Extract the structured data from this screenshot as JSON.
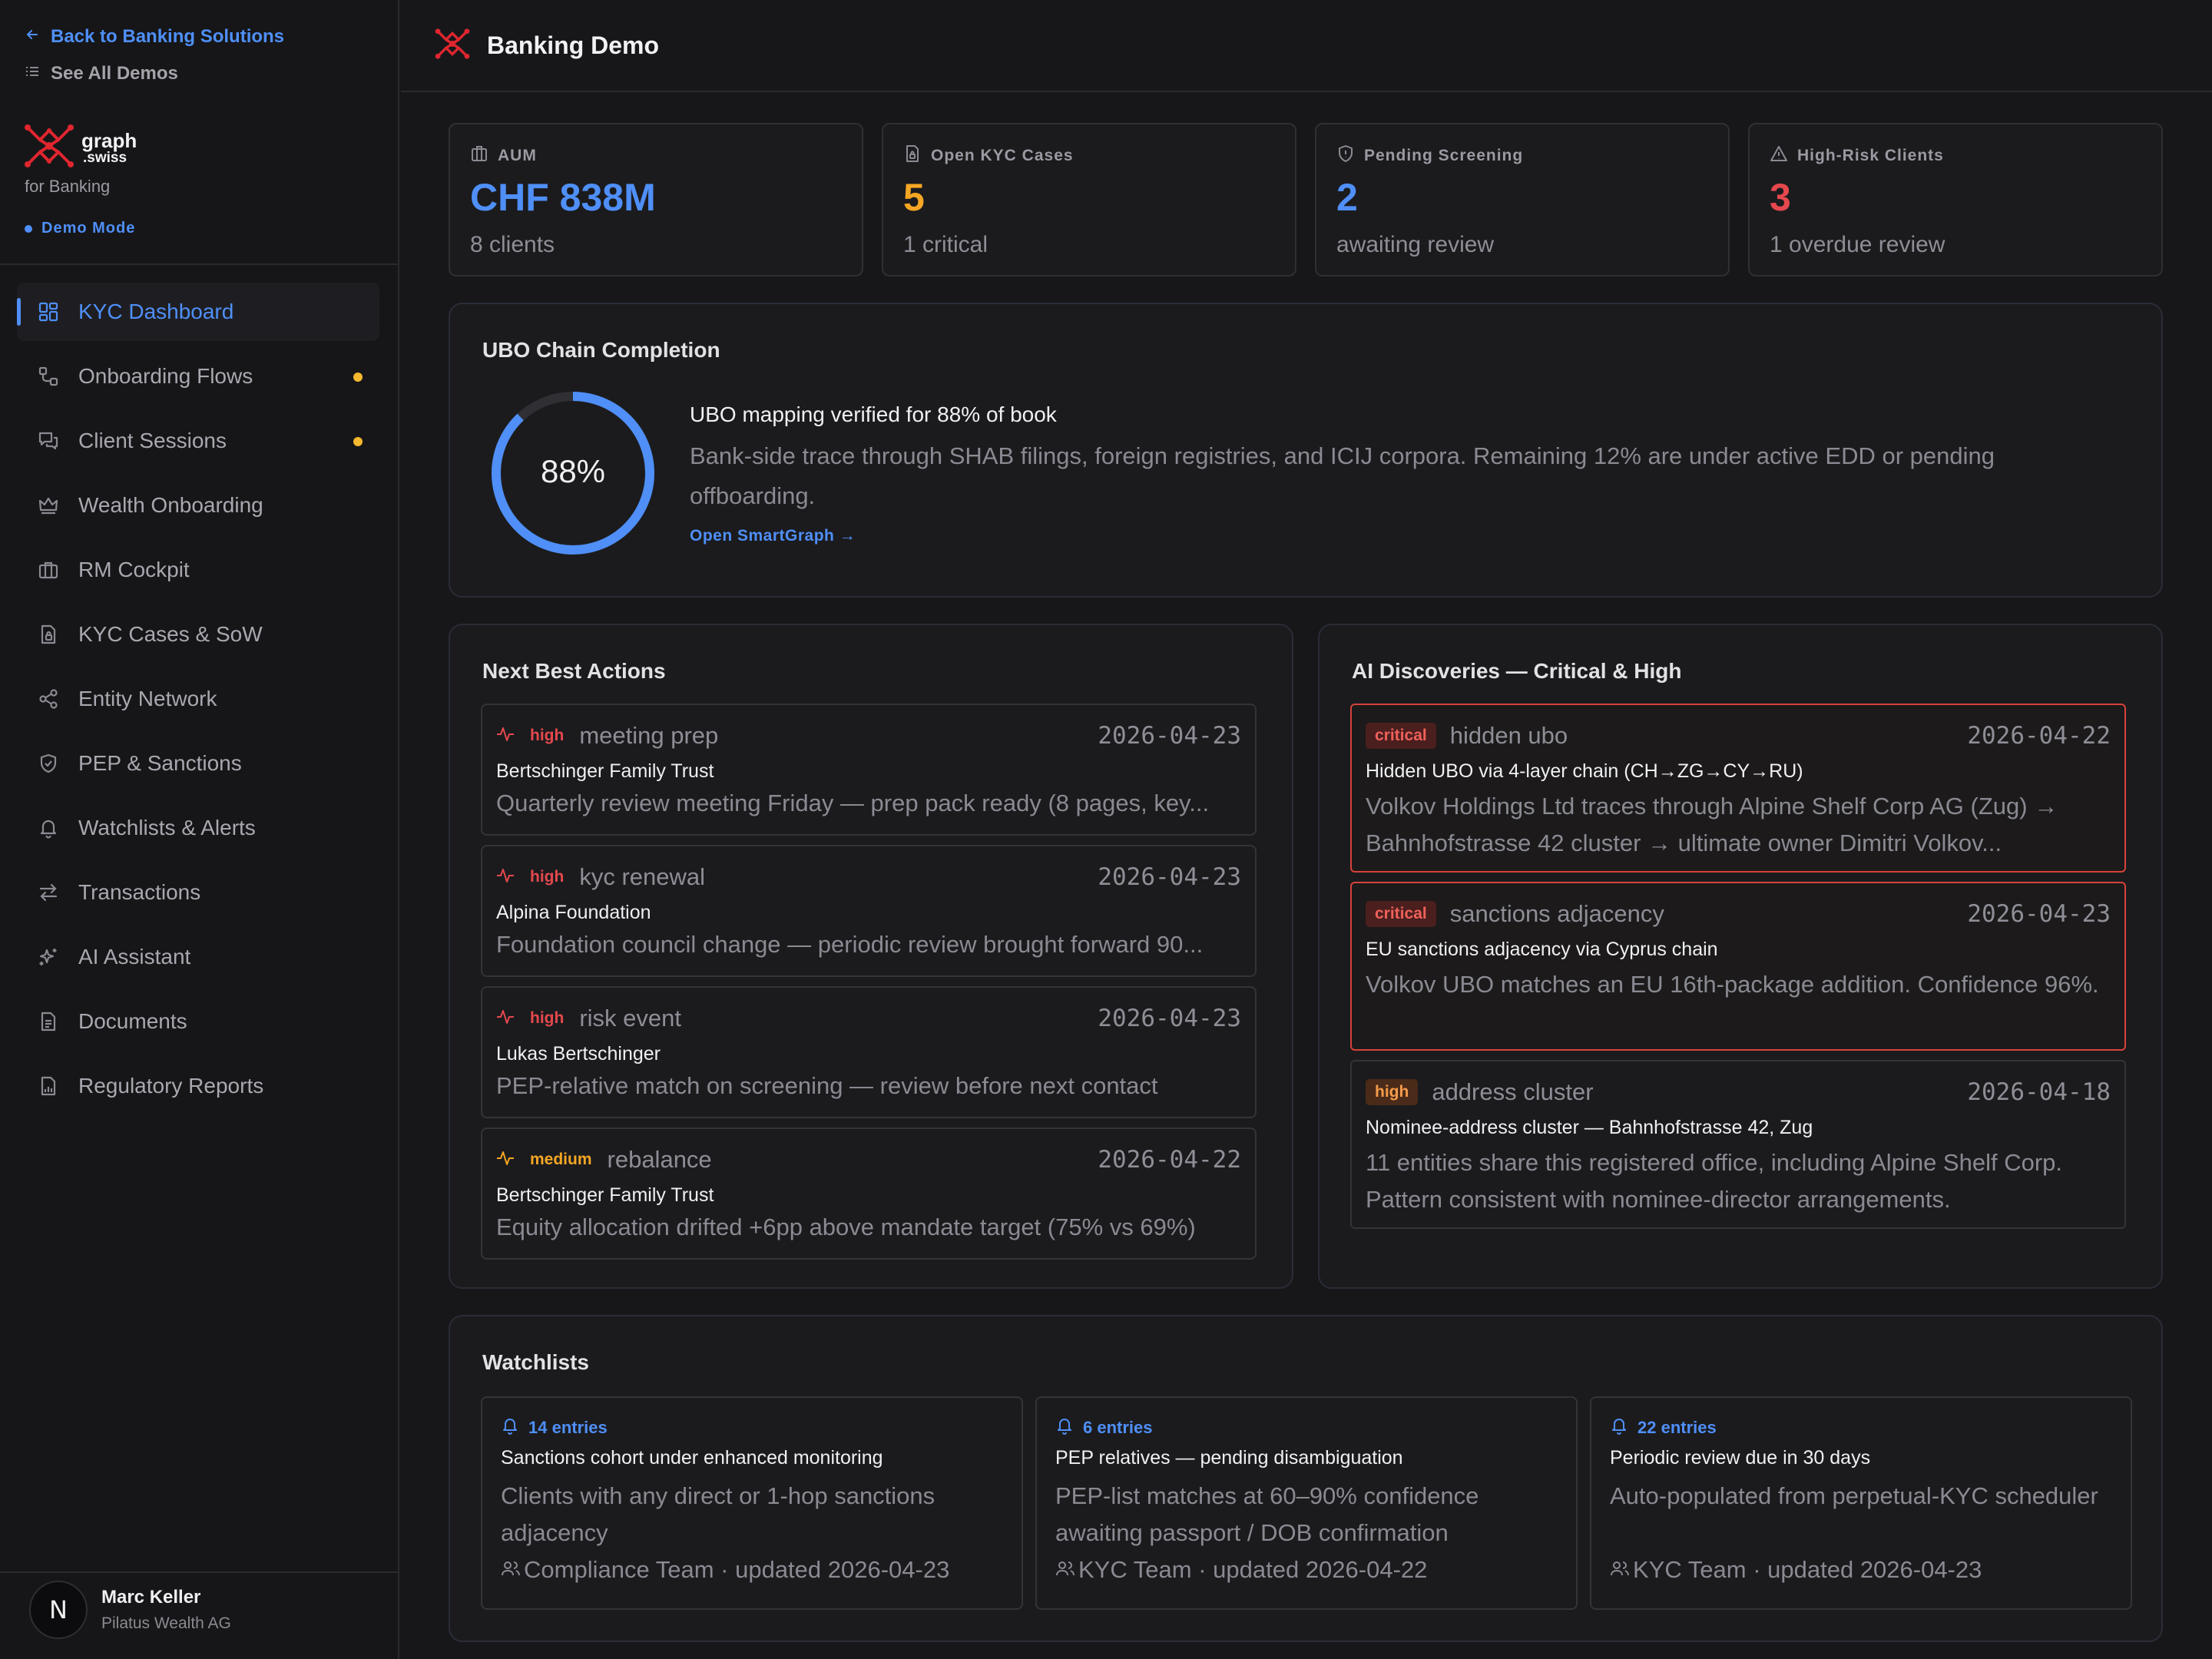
{
  "sidebar": {
    "back_label": "Back to Banking Solutions",
    "see_all_label": "See All Demos",
    "brand_name": "graph",
    "brand_suffix": ".swiss",
    "brand_sub": "for Banking",
    "demo_mode": "Demo Mode",
    "items": [
      {
        "label": "KYC Dashboard",
        "icon": "dashboard-icon",
        "active": true
      },
      {
        "label": "Onboarding Flows",
        "icon": "flow-icon",
        "dot": true
      },
      {
        "label": "Client Sessions",
        "icon": "chat-icon",
        "dot": true
      },
      {
        "label": "Wealth Onboarding",
        "icon": "crown-icon"
      },
      {
        "label": "RM Cockpit",
        "icon": "briefcase-icon"
      },
      {
        "label": "KYC Cases & SoW",
        "icon": "file-lock-icon"
      },
      {
        "label": "Entity Network",
        "icon": "share-icon"
      },
      {
        "label": "PEP & Sanctions",
        "icon": "shield-check-icon"
      },
      {
        "label": "Watchlists & Alerts",
        "icon": "bell-icon"
      },
      {
        "label": "Transactions",
        "icon": "arrows-icon"
      },
      {
        "label": "AI Assistant",
        "icon": "sparkles-icon"
      },
      {
        "label": "Documents",
        "icon": "document-icon"
      },
      {
        "label": "Regulatory Reports",
        "icon": "report-icon"
      }
    ],
    "user": {
      "initial": "N",
      "name": "Marc Keller",
      "org": "Pilatus Wealth AG"
    }
  },
  "header": {
    "title": "Banking Demo"
  },
  "stats": [
    {
      "label": "AUM",
      "value": "CHF 838M",
      "sub": "8 clients",
      "color": "#4f8ff7",
      "icon": "building-icon"
    },
    {
      "label": "Open KYC Cases",
      "value": "5",
      "sub": "1 critical",
      "color": "#f5a623",
      "icon": "file-lock-icon"
    },
    {
      "label": "Pending Screening",
      "value": "2",
      "sub": "awaiting review",
      "color": "#4f8ff7",
      "icon": "shield-icon"
    },
    {
      "label": "High-Risk Clients",
      "value": "3",
      "sub": "1 overdue review",
      "color": "#e5484d",
      "icon": "warning-icon"
    }
  ],
  "ubo": {
    "title": "UBO Chain Completion",
    "percent": 88,
    "percent_label": "88%",
    "headline": "UBO mapping verified for 88% of book",
    "description": "Bank-side trace through SHAB filings, foreign registries, and ICIJ corpora. Remaining 12% are under active EDD or pending offboarding.",
    "link": "Open SmartGraph →"
  },
  "next_actions": {
    "title": "Next Best Actions",
    "items": [
      {
        "priority": "high",
        "kind": "meeting prep",
        "date": "2026-04-23",
        "entity": "Bertschinger Family Trust",
        "desc": "Quarterly review meeting Friday — prep pack ready (8 pages, key..."
      },
      {
        "priority": "high",
        "kind": "kyc renewal",
        "date": "2026-04-23",
        "entity": "Alpina Foundation",
        "desc": "Foundation council change — periodic review brought forward 90..."
      },
      {
        "priority": "high",
        "kind": "risk event",
        "date": "2026-04-23",
        "entity": "Lukas Bertschinger",
        "desc": "PEP-relative match on screening — review before next contact"
      },
      {
        "priority": "medium",
        "kind": "rebalance",
        "date": "2026-04-22",
        "entity": "Bertschinger Family Trust",
        "desc": "Equity allocation drifted +6pp above mandate target (75% vs 69%)"
      }
    ]
  },
  "discoveries": {
    "title": "AI Discoveries — Critical & High",
    "items": [
      {
        "severity": "critical",
        "kind": "hidden ubo",
        "date": "2026-04-22",
        "entity": "Hidden UBO via 4-layer chain (CH→ZG→CY→RU)",
        "desc": "Volkov Holdings Ltd traces through Alpine Shelf Corp AG (Zug) → Bahnhofstrasse 42 cluster → ultimate owner Dimitri Volkov..."
      },
      {
        "severity": "critical",
        "kind": "sanctions adjacency",
        "date": "2026-04-23",
        "entity": "EU sanctions adjacency via Cyprus chain",
        "desc": "Volkov UBO matches an EU 16th-package addition. Confidence 96%."
      },
      {
        "severity": "high",
        "kind": "address cluster",
        "date": "2026-04-18",
        "entity": "Nominee-address cluster — Bahnhofstrasse 42, Zug",
        "desc": "11 entities share this registered office, including Alpine Shelf Corp. Pattern consistent with nominee-director arrangements."
      }
    ]
  },
  "watchlists": {
    "title": "Watchlists",
    "items": [
      {
        "count": "14 entries",
        "name": "Sanctions cohort under enhanced monitoring",
        "desc": "Clients with any direct or 1-hop sanctions adjacency",
        "footer": "Compliance Team · updated 2026-04-23"
      },
      {
        "count": "6 entries",
        "name": "PEP relatives — pending disambiguation",
        "desc": "PEP-list matches at 60–90% confidence awaiting passport / DOB confirmation",
        "footer": "KYC Team · updated 2026-04-22"
      },
      {
        "count": "22 entries",
        "name": "Periodic review due in 30 days",
        "desc": "Auto-populated from perpetual-KYC scheduler",
        "footer": "KYC Team · updated 2026-04-23"
      }
    ]
  },
  "colors": {
    "accent": "#4f8ff7",
    "critical": "#e5484d",
    "high": "#f0605a",
    "medium": "#f5a623",
    "brand": "#e0262f"
  }
}
